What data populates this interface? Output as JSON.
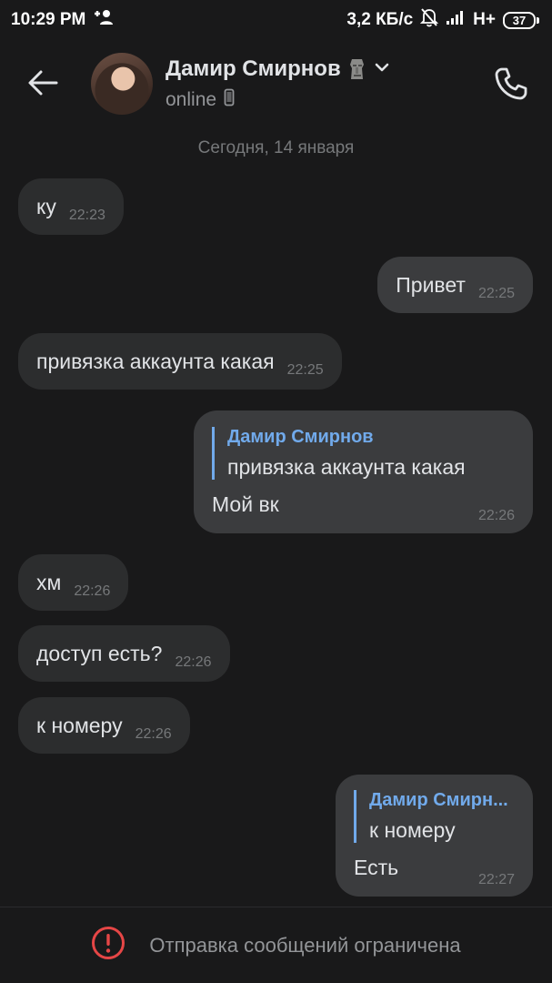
{
  "status_bar": {
    "time": "10:29 PM",
    "network_speed": "3,2 КБ/с",
    "network_type": "H+",
    "battery": "37",
    "icons": [
      "add-user-icon",
      "bell-off-icon",
      "signal-icon",
      "battery-icon"
    ]
  },
  "header": {
    "contact_name": "Дамир Смирнов",
    "status": "online",
    "icons": [
      "back-arrow-icon",
      "moai-emoji-icon",
      "chevron-down-icon",
      "phone-device-icon",
      "call-icon"
    ]
  },
  "chat": {
    "date_separator": "Сегодня, 14 января",
    "messages": [
      {
        "direction": "in",
        "text": "ку",
        "time": "22:23"
      },
      {
        "direction": "out",
        "text": "Привет",
        "time": "22:25"
      },
      {
        "direction": "in",
        "text": "привязка аккаунта какая",
        "time": "22:25"
      },
      {
        "direction": "out",
        "reply_author": "Дамир Смирнов",
        "reply_text": "привязка аккаунта какая",
        "text": "Мой вк",
        "time": "22:26"
      },
      {
        "direction": "in",
        "text": "хм",
        "time": "22:26"
      },
      {
        "direction": "in",
        "text": "доступ есть?",
        "time": "22:26"
      },
      {
        "direction": "in",
        "text": "к номеру",
        "time": "22:26"
      },
      {
        "direction": "out",
        "reply_author": "Дамир Смирн...",
        "reply_text": "к номеру",
        "text": "Есть",
        "time": "22:27"
      }
    ]
  },
  "bottom_bar": {
    "notice": "Отправка сообщений ограничена",
    "icon": "warning-circle-icon",
    "accent_color": "#e64646"
  },
  "colors": {
    "background": "#19191a",
    "incoming_bubble": "#2c2d2e",
    "outgoing_bubble": "#3b3c3e",
    "reply_accent": "#71aaeb",
    "secondary_text": "#76787a"
  }
}
